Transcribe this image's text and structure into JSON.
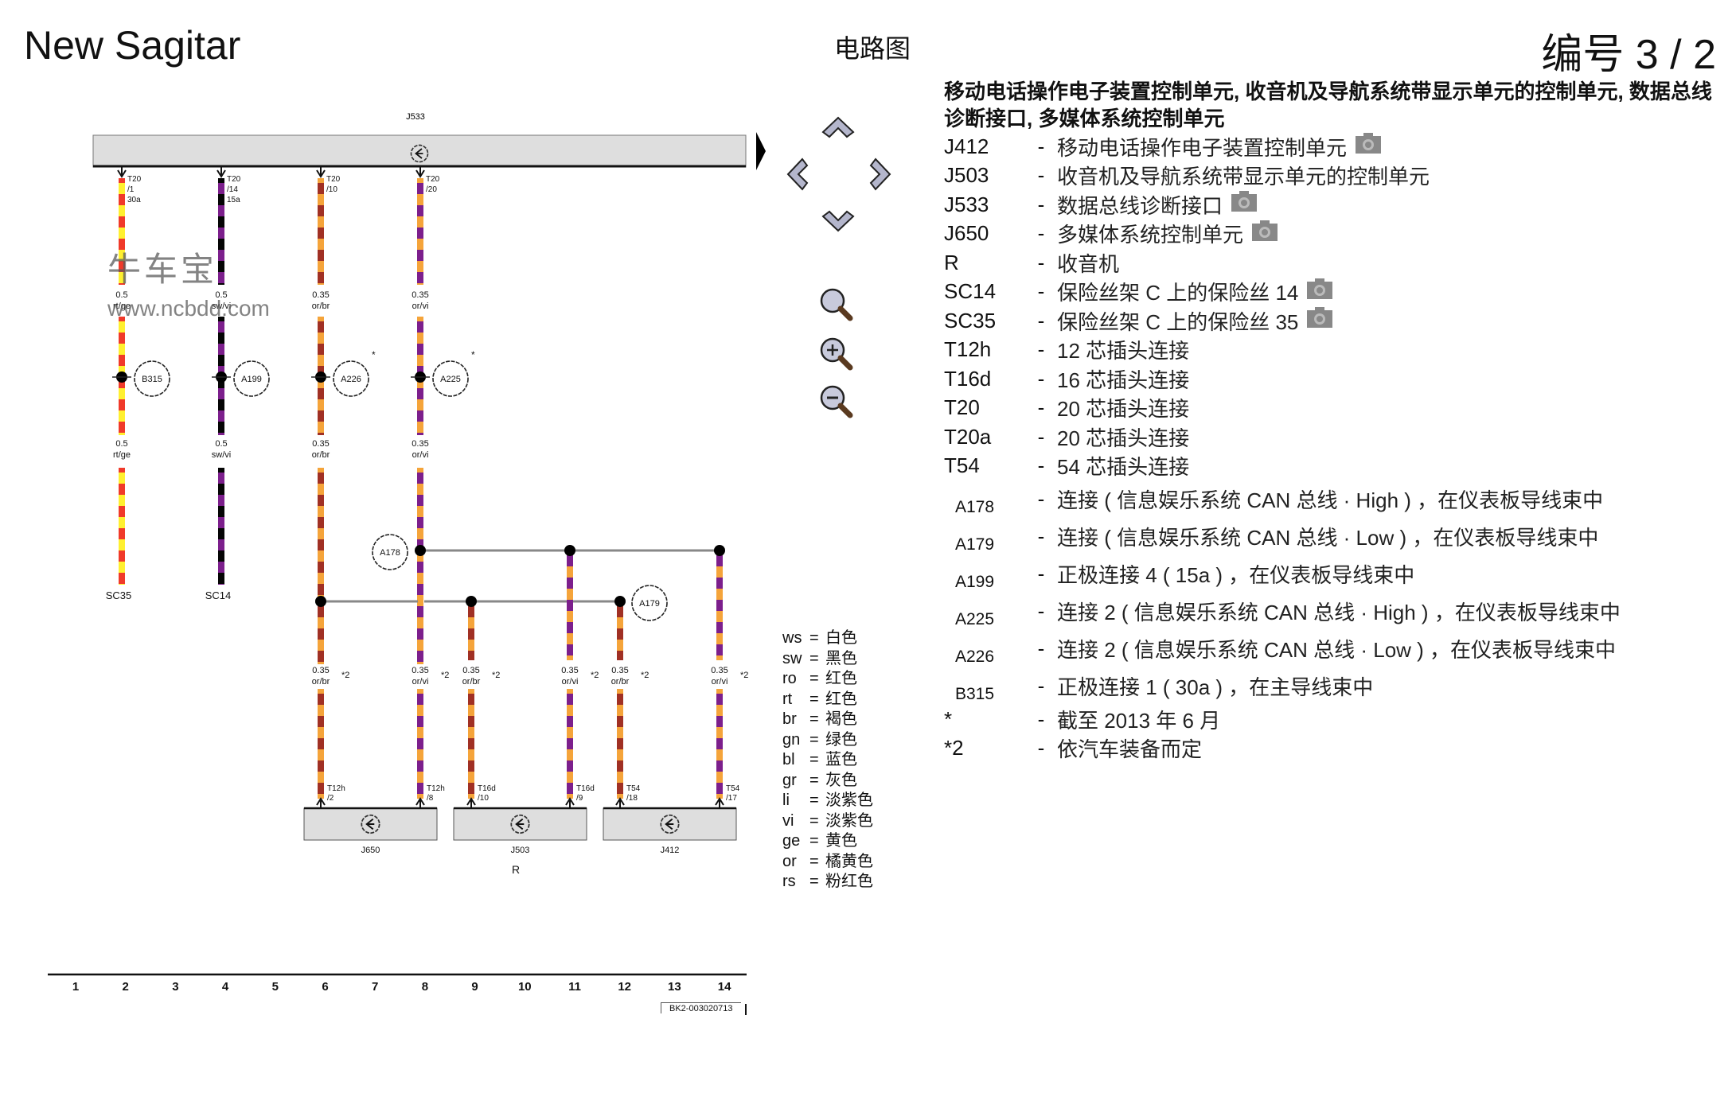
{
  "header": {
    "title": "New Sagitar",
    "center_title": "电路图",
    "page_number": "编号  3 / 2"
  },
  "watermark": {
    "brand": "牛车宝",
    "url": "www.ncbdd.com"
  },
  "navigation": {
    "pan_up": "chevron-up-icon",
    "pan_left": "chevron-left-icon",
    "pan_right": "chevron-right-icon",
    "pan_down": "chevron-down-icon",
    "zoom_fit": "magnifier-icon",
    "zoom_in": "zoom-in-icon",
    "zoom_out": "zoom-out-icon"
  },
  "diagram": {
    "top_component": {
      "id": "J533"
    },
    "bottom_components": [
      {
        "id": "J650"
      },
      {
        "id": "J503"
      },
      {
        "id": "J412"
      }
    ],
    "group_label": "R",
    "top_wires": [
      {
        "connector": "T20",
        "pin": "/1",
        "extra": "30a",
        "size": "0.5",
        "color_code": "rt/ge",
        "junction": "B315",
        "end_label": "SC35",
        "colors": [
          "#f03a2a",
          "#fff030"
        ]
      },
      {
        "connector": "T20",
        "pin": "/14",
        "extra": "15a",
        "size": "0.5",
        "color_code": "sw/vi",
        "junction": "A199",
        "end_label": "SC14",
        "colors": [
          "#050505",
          "#7c1f8c"
        ]
      },
      {
        "connector": "T20",
        "pin": "/10",
        "extra": "",
        "size": "0.35",
        "color_code": "or/br",
        "junction": "A226",
        "junction_note": "*",
        "colors": [
          "#f5a43a",
          "#a03024"
        ]
      },
      {
        "connector": "T20",
        "pin": "/20",
        "extra": "",
        "size": "0.35",
        "color_code": "or/vi",
        "junction": "A225",
        "junction_note": "*",
        "colors": [
          "#f5a43a",
          "#7c1f8c"
        ]
      }
    ],
    "bus_junctions": {
      "high": "A178",
      "low": "A179"
    },
    "bottom_wires": [
      {
        "size": "0.35",
        "color_code": "or/br",
        "note": "*2",
        "connector": "T12h",
        "pin": "/2"
      },
      {
        "size": "0.35",
        "color_code": "or/vi",
        "note": "*2",
        "connector": "T12h",
        "pin": "/8"
      },
      {
        "size": "0.35",
        "color_code": "or/br",
        "note": "*2",
        "connector": "T16d",
        "pin": "/10"
      },
      {
        "size": "0.35",
        "color_code": "or/vi",
        "note": "*2",
        "connector": "T16d",
        "pin": "/9"
      },
      {
        "size": "0.35",
        "color_code": "or/br",
        "note": "*2",
        "connector": "T54",
        "pin": "/18"
      },
      {
        "size": "0.35",
        "color_code": "or/vi",
        "note": "*2",
        "connector": "T54",
        "pin": "/17"
      }
    ],
    "ruler": [
      "1",
      "2",
      "3",
      "4",
      "5",
      "6",
      "7",
      "8",
      "9",
      "10",
      "11",
      "12",
      "13",
      "14"
    ],
    "doc_id": "BK2-003020713"
  },
  "legend": [
    {
      "code": "ws",
      "meaning": "白色"
    },
    {
      "code": "sw",
      "meaning": "黑色"
    },
    {
      "code": "ro",
      "meaning": "红色"
    },
    {
      "code": "rt",
      "meaning": "红色"
    },
    {
      "code": "br",
      "meaning": "褐色"
    },
    {
      "code": "gn",
      "meaning": "绿色"
    },
    {
      "code": "bl",
      "meaning": "蓝色"
    },
    {
      "code": "gr",
      "meaning": "灰色"
    },
    {
      "code": "li",
      "meaning": "淡紫色"
    },
    {
      "code": "vi",
      "meaning": "淡紫色"
    },
    {
      "code": "ge",
      "meaning": "黄色"
    },
    {
      "code": "or",
      "meaning": "橘黄色"
    },
    {
      "code": "rs",
      "meaning": "粉红色"
    }
  ],
  "description": {
    "heading": "移动电话操作电子装置控制单元, 收音机及导航系统带显示单元的控制单元, 数据总线诊断接口, 多媒体系统控制单元",
    "items": [
      {
        "code": "J412",
        "text": "移动电话操作电子装置控制单元",
        "photo": true
      },
      {
        "code": "J503",
        "text": "收音机及导航系统带显示单元的控制单元",
        "photo": false
      },
      {
        "code": "J533",
        "text": "数据总线诊断接口",
        "photo": true
      },
      {
        "code": "J650",
        "text": "多媒体系统控制单元",
        "photo": true
      },
      {
        "code": "R",
        "text": "收音机",
        "photo": false
      },
      {
        "code": "SC14",
        "text": "保险丝架 C 上的保险丝 14",
        "photo": true
      },
      {
        "code": "SC35",
        "text": "保险丝架 C 上的保险丝 35",
        "photo": true
      },
      {
        "code": "T12h",
        "text": "12 芯插头连接",
        "photo": false
      },
      {
        "code": "T16d",
        "text": "16 芯插头连接",
        "photo": false
      },
      {
        "code": "T20",
        "text": "20 芯插头连接",
        "photo": false
      },
      {
        "code": "T20a",
        "text": "20 芯插头连接",
        "photo": false
      },
      {
        "code": "T54",
        "text": "54 芯插头连接",
        "photo": false
      }
    ],
    "connections": [
      {
        "code": "A178",
        "text": "连接 ( 信息娱乐系统 CAN 总线 · High ) ，在仪表板导线束中"
      },
      {
        "code": "A179",
        "text": "连接 ( 信息娱乐系统 CAN 总线 · Low ) ，在仪表板导线束中"
      },
      {
        "code": "A199",
        "text": "正极连接 4 ( 15a ) ，在仪表板导线束中"
      },
      {
        "code": "A225",
        "text": "连接 2 ( 信息娱乐系统 CAN 总线 · High ) ，在仪表板导线束中"
      },
      {
        "code": "A226",
        "text": "连接 2 ( 信息娱乐系统 CAN 总线 · Low ) ，在仪表板导线束中"
      },
      {
        "code": "B315",
        "text": "正极连接 1 ( 30a ) ，在主导线束中"
      }
    ],
    "notes": [
      {
        "code": "*",
        "text": "截至 2013 年 6 月"
      },
      {
        "code": "*2",
        "text": "依汽车装备而定"
      }
    ],
    "dash": "-"
  },
  "colors": {
    "orange": "#f5a43a",
    "brown": "#a03024",
    "violet": "#7c1f8c",
    "red": "#f03a2a",
    "yellow": "#fff030",
    "black": "#050505",
    "component_fill": "#dedede",
    "bus_line": "#888888"
  }
}
